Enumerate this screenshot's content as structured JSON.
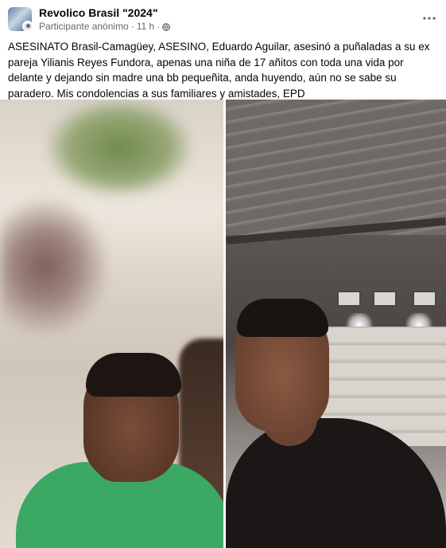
{
  "post": {
    "group_name": "Revolico Brasil \"2024\"",
    "author": "Participante anónimo",
    "separator": "·",
    "time": "11 h",
    "separator2": "·",
    "privacy_icon": "globe-icon",
    "more_icon": "more-options-icon",
    "text": "ASESINATO Brasil-Camagüey, ASESINO, Eduardo Aguilar, asesinó a puñaladas a su ex pareja Yilianis Reyes Fundora, apenas una niña de 17 añitos con toda una vida por delante y dejando sin madre una bb pequeñita, anda huyendo, aún no se sabe su paradero. Mis condolencias a sus familiares y amistades, EPD"
  },
  "colors": {
    "text": "#050505",
    "meta": "#65676b",
    "background": "#ffffff"
  }
}
